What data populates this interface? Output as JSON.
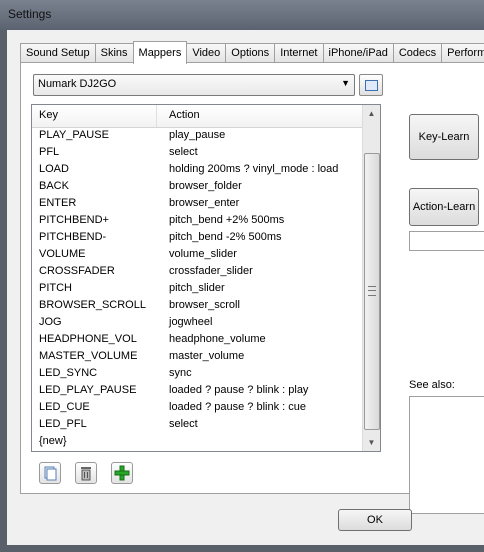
{
  "window": {
    "title": "Settings"
  },
  "tabs": [
    {
      "label": "Sound Setup",
      "active": false
    },
    {
      "label": "Skins",
      "active": false
    },
    {
      "label": "Mappers",
      "active": true
    },
    {
      "label": "Video",
      "active": false
    },
    {
      "label": "Options",
      "active": false
    },
    {
      "label": "Internet",
      "active": false
    },
    {
      "label": "iPhone/iPad",
      "active": false
    },
    {
      "label": "Codecs",
      "active": false
    },
    {
      "label": "Perform",
      "active": false
    }
  ],
  "mapper": {
    "device_selected": "Numark DJ2GO",
    "columns": {
      "key": "Key",
      "action": "Action"
    },
    "rows": [
      {
        "key": "PLAY_PAUSE",
        "action": "play_pause"
      },
      {
        "key": "PFL",
        "action": "select"
      },
      {
        "key": "LOAD",
        "action": "holding 200ms ? vinyl_mode : load"
      },
      {
        "key": "BACK",
        "action": "browser_folder"
      },
      {
        "key": "ENTER",
        "action": "browser_enter"
      },
      {
        "key": "PITCHBEND+",
        "action": "pitch_bend +2% 500ms"
      },
      {
        "key": "PITCHBEND-",
        "action": "pitch_bend -2% 500ms"
      },
      {
        "key": "VOLUME",
        "action": "volume_slider"
      },
      {
        "key": "CROSSFADER",
        "action": "crossfader_slider"
      },
      {
        "key": "PITCH",
        "action": "pitch_slider"
      },
      {
        "key": "BROWSER_SCROLL",
        "action": "browser_scroll"
      },
      {
        "key": "JOG",
        "action": "jogwheel"
      },
      {
        "key": "HEADPHONE_VOL",
        "action": "headphone_volume"
      },
      {
        "key": "MASTER_VOLUME",
        "action": "master_volume"
      },
      {
        "key": "LED_SYNC",
        "action": "sync"
      },
      {
        "key": "LED_PLAY_PAUSE",
        "action": "loaded ? pause ? blink : play"
      },
      {
        "key": "LED_CUE",
        "action": "loaded ? pause ? blink : cue"
      },
      {
        "key": "LED_PFL",
        "action": "select"
      },
      {
        "key": "{new}",
        "action": ""
      }
    ]
  },
  "side": {
    "key_learn": "Key-Learn",
    "action_learn": "Action-Learn",
    "see_also": "See also:"
  },
  "footer": {
    "ok": "OK"
  },
  "icons": {
    "add": "green-plus-icon",
    "delete": "trash-icon",
    "duplicate": "copy-icon",
    "edit": "list-icon"
  }
}
